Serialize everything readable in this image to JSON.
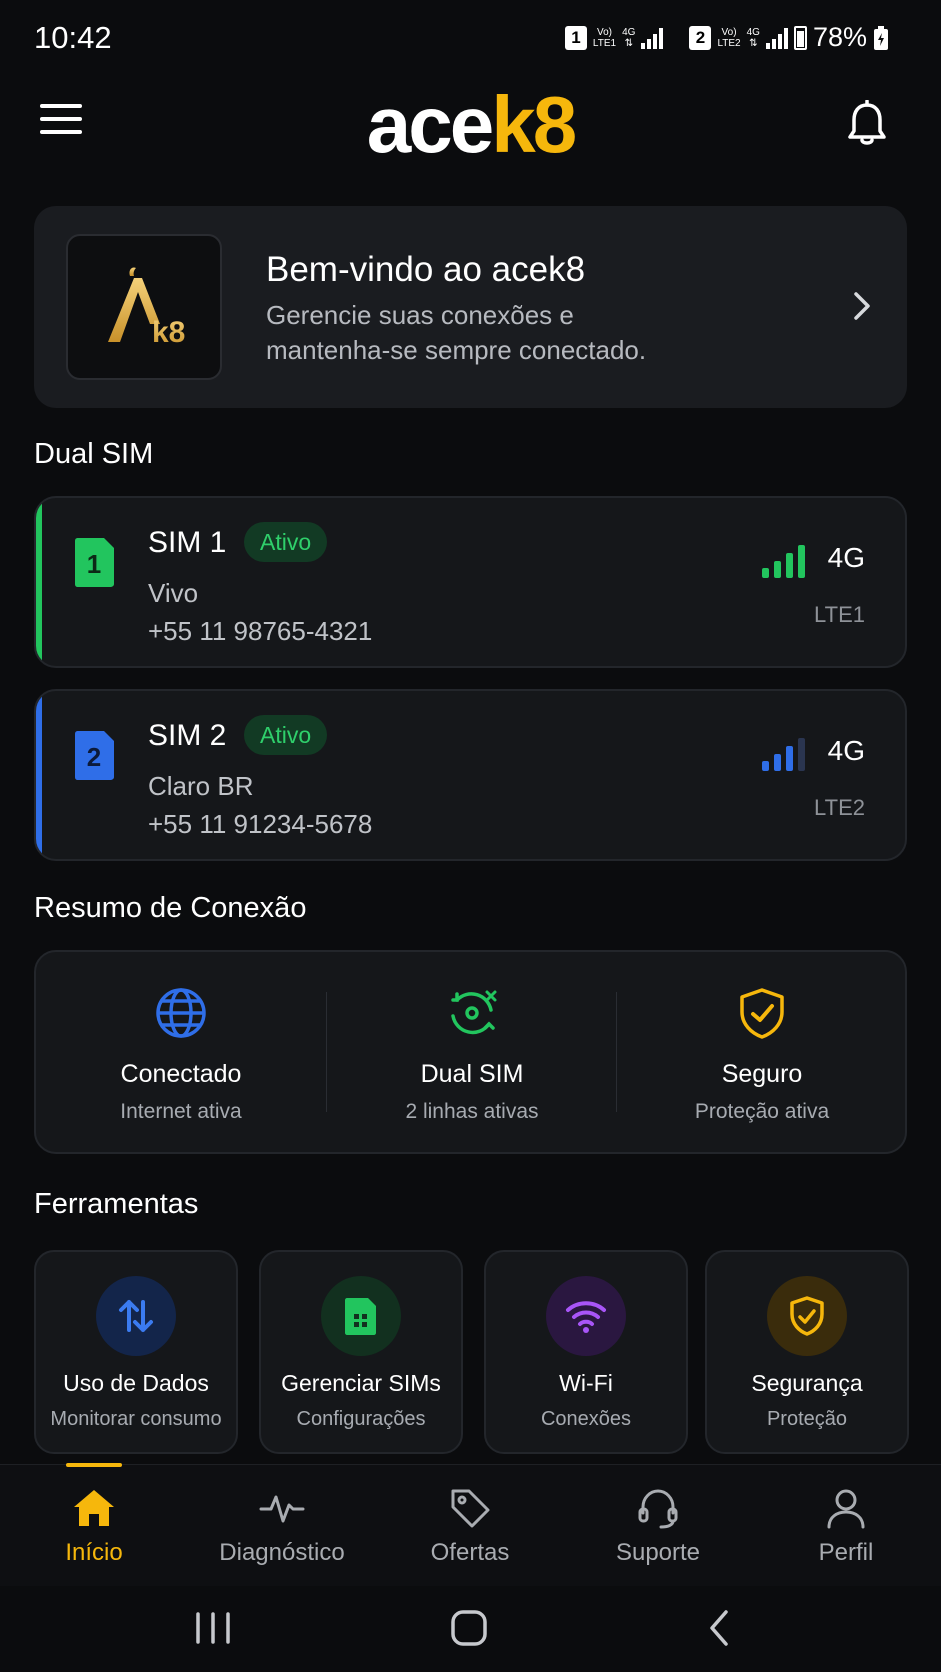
{
  "status_bar": {
    "time": "10:42",
    "sim1_slot": "1",
    "sim1_volte": "Vo)",
    "sim1_lte": "LTE1",
    "sim1_net": "4G",
    "sim2_slot": "2",
    "sim2_volte": "Vo)",
    "sim2_lte": "LTE2",
    "sim2_net": "4G",
    "battery": "78%"
  },
  "header": {
    "logo_part1": "ace",
    "logo_part2": "k8",
    "menu_icon": "menu-icon",
    "bell_icon": "bell-icon"
  },
  "welcome": {
    "title": "Bem-vindo ao acek8",
    "subtitle_line1": "Gerencie suas conexões e",
    "subtitle_line2": "mantenha-se sempre conectado."
  },
  "dual_sim": {
    "section_title": "Dual SIM",
    "sims": [
      {
        "slot": "1",
        "name": "SIM 1",
        "status": "Ativo",
        "carrier": "Vivo",
        "number": "+55 11 98765-4321",
        "network": "4G",
        "lte": "LTE1",
        "signal_level": 4,
        "accent_color": "#22c55e"
      },
      {
        "slot": "2",
        "name": "SIM 2",
        "status": "Ativo",
        "carrier": "Claro BR",
        "number": "+55 11 91234-5678",
        "network": "4G",
        "lte": "LTE2",
        "signal_level": 3,
        "accent_color": "#2f6ee8"
      }
    ]
  },
  "summary": {
    "section_title": "Resumo de Conexão",
    "items": [
      {
        "title": "Conectado",
        "subtitle": "Internet ativa",
        "icon": "globe-icon",
        "color": "#2f6ee8"
      },
      {
        "title": "Dual SIM",
        "subtitle": "2 linhas ativas",
        "icon": "sync-icon",
        "color": "#22c55e"
      },
      {
        "title": "Seguro",
        "subtitle": "Proteção ativa",
        "icon": "shield-check-icon",
        "color": "#f6b70c"
      }
    ]
  },
  "tools": {
    "section_title": "Ferramentas",
    "items": [
      {
        "title": "Uso de Dados",
        "subtitle": "Monitorar consumo",
        "icon": "data-transfer-icon",
        "color": "#2f6ee8"
      },
      {
        "title": "Gerenciar SIMs",
        "subtitle": "Configurações",
        "icon": "sim-card-icon",
        "color": "#22c55e"
      },
      {
        "title": "Wi-Fi",
        "subtitle": "Conexões",
        "icon": "wifi-icon",
        "color": "#a855f7"
      },
      {
        "title": "Segurança",
        "subtitle": "Proteção",
        "icon": "shield-icon",
        "color": "#f6b70c"
      }
    ]
  },
  "bottom_nav": {
    "items": [
      {
        "label": "Início",
        "icon": "home-icon",
        "active": true
      },
      {
        "label": "Diagnóstico",
        "icon": "pulse-icon",
        "active": false
      },
      {
        "label": "Ofertas",
        "icon": "tag-icon",
        "active": false
      },
      {
        "label": "Suporte",
        "icon": "headset-icon",
        "active": false
      },
      {
        "label": "Perfil",
        "icon": "user-icon",
        "active": false
      }
    ]
  },
  "colors": {
    "brand": "#f6b70c",
    "background": "#0b0c0e",
    "card": "#15171a",
    "active_badge": "#2fcf6b"
  }
}
